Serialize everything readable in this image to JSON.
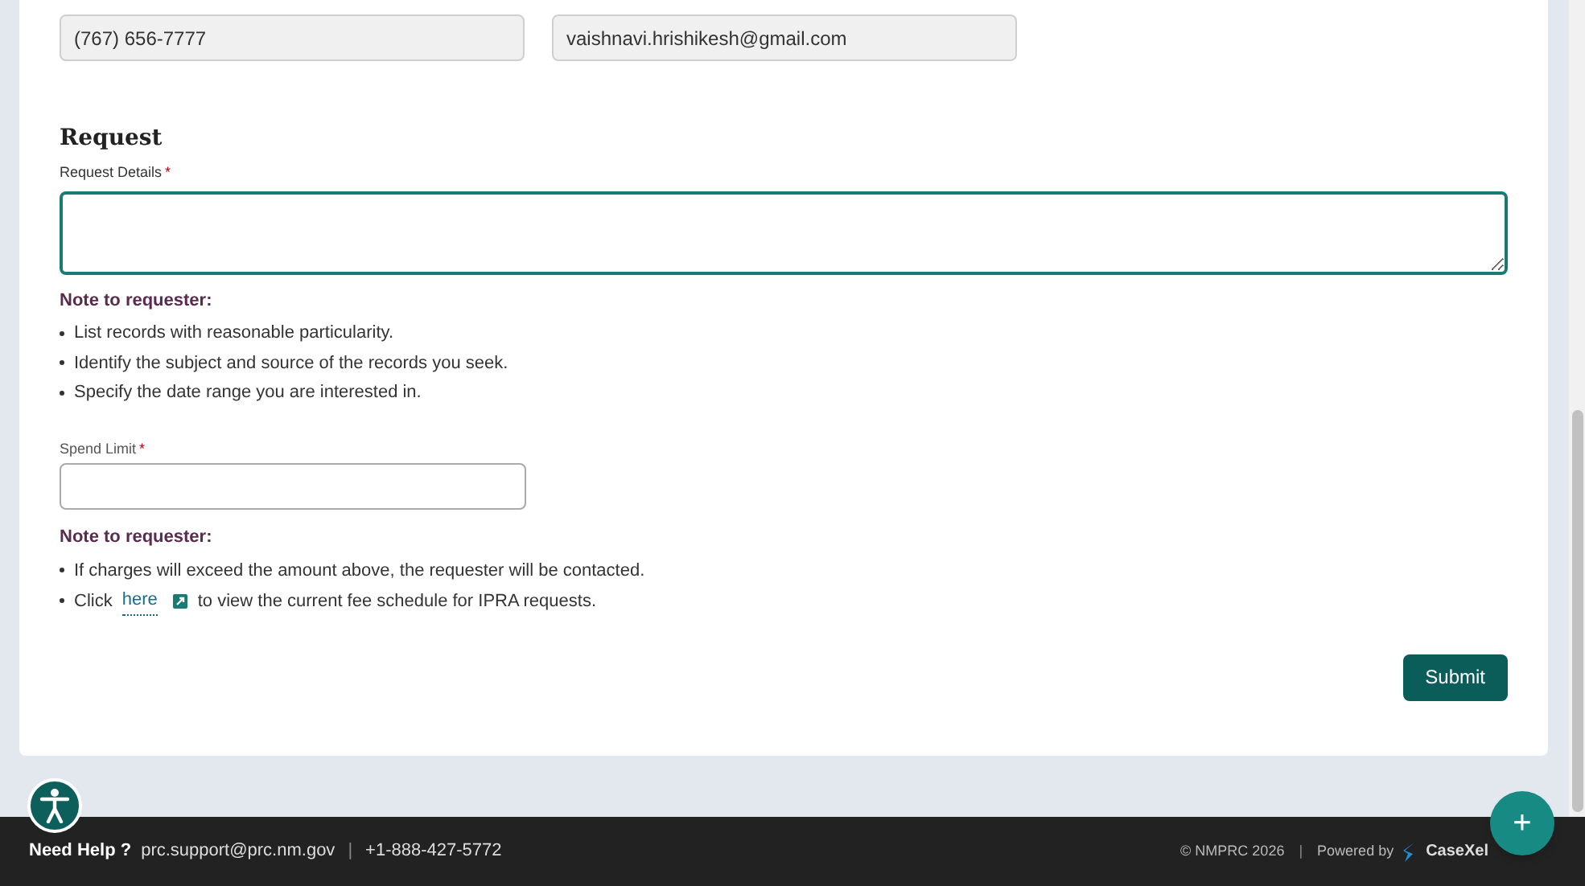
{
  "contact": {
    "phone": {
      "value": "(767) 656-7777"
    },
    "email": {
      "value": "vaishnavi.hrishikesh@gmail.com"
    }
  },
  "request": {
    "heading": "Request",
    "details": {
      "label": "Request Details",
      "required_mark": "*",
      "focused": true
    },
    "note1": {
      "title": "Note to requester:",
      "items": [
        "List records with reasonable particularity.",
        "Identify the subject and source of the records you seek.",
        "Specify the date range you are interested in."
      ]
    },
    "spend": {
      "label": "Spend Limit",
      "required_mark": "*"
    },
    "note2": {
      "title": "Note to requester:",
      "item1": "If charges will exceed the amount above, the requester will be contacted.",
      "item2": {
        "before": "Click",
        "link": "here",
        "after": "to view the current fee schedule for IPRA requests."
      }
    },
    "submit": "Submit"
  },
  "footer": {
    "help": "Need Help ?",
    "email": "prc.support@prc.nm.gov",
    "sep1": "|",
    "phone": "+1-888-427-5772",
    "copyright": "© NMPRC 2026",
    "sep2": "|",
    "powered": "Powered by",
    "brand": "CaseXel"
  },
  "fab": "+"
}
